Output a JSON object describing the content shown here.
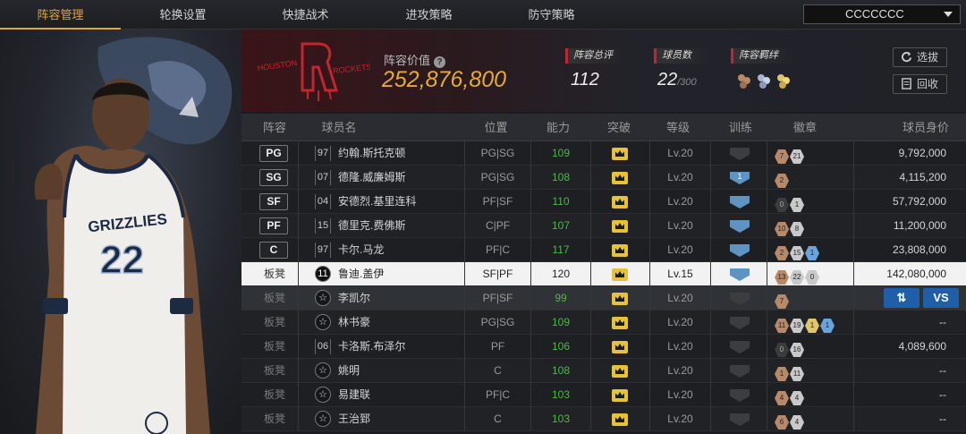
{
  "nav": {
    "tabs": [
      {
        "label": "阵容管理",
        "active": true
      },
      {
        "label": "轮换设置",
        "active": false
      },
      {
        "label": "快捷战术",
        "active": false
      },
      {
        "label": "进攻策略",
        "active": false
      },
      {
        "label": "防守策略",
        "active": false
      }
    ],
    "team_select": "CCCCCCC"
  },
  "header": {
    "value_label": "阵容价值",
    "value_help": "?",
    "value": "252,876,800",
    "rating_label": "阵容总评",
    "rating": "112",
    "players_label": "球员数",
    "players": "22",
    "players_max": "/300",
    "bonds_label": "阵容羁绊",
    "btn_select": "选拔",
    "btn_recycle": "回收",
    "logo_text_left": "HOUSTON",
    "logo_text_right": "ROCKETS"
  },
  "table": {
    "headers": [
      "阵容",
      "球员名",
      "位置",
      "能力",
      "突破",
      "等级",
      "训练",
      "徽章",
      "球员身价"
    ],
    "rows": [
      {
        "slot": "PG",
        "starter": true,
        "num": "97",
        "name": "约翰.斯托克顿",
        "pos": "PG|SG",
        "ability": "109",
        "level": "Lv.20",
        "train": "",
        "train_blue": false,
        "badges": [
          [
            "br",
            "7"
          ],
          [
            "sv",
            "21"
          ]
        ],
        "price": "9,792,000"
      },
      {
        "slot": "SG",
        "starter": true,
        "num": "07",
        "name": "德隆.威廉姆斯",
        "pos": "PG|SG",
        "ability": "108",
        "level": "Lv.20",
        "train": "1",
        "train_blue": true,
        "badges": [
          [
            "br",
            "2"
          ]
        ],
        "price": "4,115,200"
      },
      {
        "slot": "SF",
        "starter": true,
        "num": "04",
        "name": "安德烈.基里连科",
        "pos": "PF|SF",
        "ability": "110",
        "level": "Lv.20",
        "train": "",
        "train_blue": true,
        "badges": [
          [
            "dk",
            "0"
          ],
          [
            "sv",
            "1"
          ]
        ],
        "price": "57,792,000"
      },
      {
        "slot": "PF",
        "starter": true,
        "num": "15",
        "name": "德里克.费佛斯",
        "pos": "C|PF",
        "ability": "107",
        "level": "Lv.20",
        "train": "",
        "train_blue": true,
        "badges": [
          [
            "br",
            "10"
          ],
          [
            "sv",
            "8"
          ]
        ],
        "price": "11,200,000"
      },
      {
        "slot": "C",
        "starter": true,
        "num": "97",
        "name": "卡尔.马龙",
        "pos": "PF|C",
        "ability": "117",
        "level": "Lv.20",
        "train": "",
        "train_blue": true,
        "badges": [
          [
            "br",
            "2"
          ],
          [
            "sv",
            "15"
          ],
          [
            "bl",
            "1"
          ]
        ],
        "price": "23,808,000"
      },
      {
        "slot": "板凳",
        "starter": false,
        "selected": true,
        "num": "11",
        "name": "鲁迪.盖伊",
        "pos": "SF|PF",
        "ability": "120",
        "level": "Lv.15",
        "train": "",
        "train_blue": true,
        "badges": [
          [
            "br",
            "13"
          ],
          [
            "sv",
            "22"
          ],
          [
            "sv",
            "0"
          ]
        ],
        "price": "142,080,000"
      },
      {
        "slot": "板凳",
        "starter": false,
        "dim": true,
        "num": "",
        "name": "李凯尔",
        "pos": "PF|SF",
        "ability": "99",
        "level": "Lv.20",
        "train": "",
        "train_blue": false,
        "badges": [
          [
            "br",
            "7"
          ]
        ],
        "price": "",
        "actions": {
          "swap": "⇅",
          "vs": "VS"
        }
      },
      {
        "slot": "板凳",
        "starter": false,
        "num": "",
        "name": "林书豪",
        "pos": "PG|SG",
        "ability": "109",
        "level": "Lv.20",
        "train": "",
        "train_blue": false,
        "badges": [
          [
            "br",
            "11"
          ],
          [
            "sv",
            "19"
          ],
          [
            "gd",
            "1"
          ],
          [
            "bl",
            "1"
          ]
        ],
        "price": "--"
      },
      {
        "slot": "板凳",
        "starter": false,
        "num": "06",
        "name": "卡洛斯.布泽尔",
        "pos": "PF",
        "ability": "106",
        "level": "Lv.20",
        "train": "",
        "train_blue": false,
        "badges": [
          [
            "dk",
            "0"
          ],
          [
            "sv",
            "16"
          ]
        ],
        "price": "4,089,600"
      },
      {
        "slot": "板凳",
        "starter": false,
        "num": "",
        "name": "姚明",
        "pos": "C",
        "ability": "108",
        "level": "Lv.20",
        "train": "",
        "train_blue": false,
        "badges": [
          [
            "br",
            "1"
          ],
          [
            "sv",
            "11"
          ]
        ],
        "price": "--"
      },
      {
        "slot": "板凳",
        "starter": false,
        "num": "",
        "name": "易建联",
        "pos": "PF|C",
        "ability": "103",
        "level": "Lv.20",
        "train": "",
        "train_blue": false,
        "badges": [
          [
            "br",
            "4"
          ],
          [
            "sv",
            "4"
          ]
        ],
        "price": "--"
      },
      {
        "slot": "板凳",
        "starter": false,
        "num": "",
        "name": "王治郅",
        "pos": "C",
        "ability": "103",
        "level": "Lv.20",
        "train": "",
        "train_blue": false,
        "badges": [
          [
            "br",
            "6"
          ],
          [
            "sv",
            "4"
          ]
        ],
        "price": "--"
      }
    ]
  },
  "player_panel": {
    "jersey_team": "GRIZZLIES",
    "jersey_number": "22"
  },
  "colors": {
    "accent": "#e0a43a",
    "value": "#e6a93c",
    "ability_green": "#4fb64a",
    "badge_blue": "#6aa4de",
    "action_blue": "#1e5fa8",
    "team_red": "#c0262e"
  }
}
